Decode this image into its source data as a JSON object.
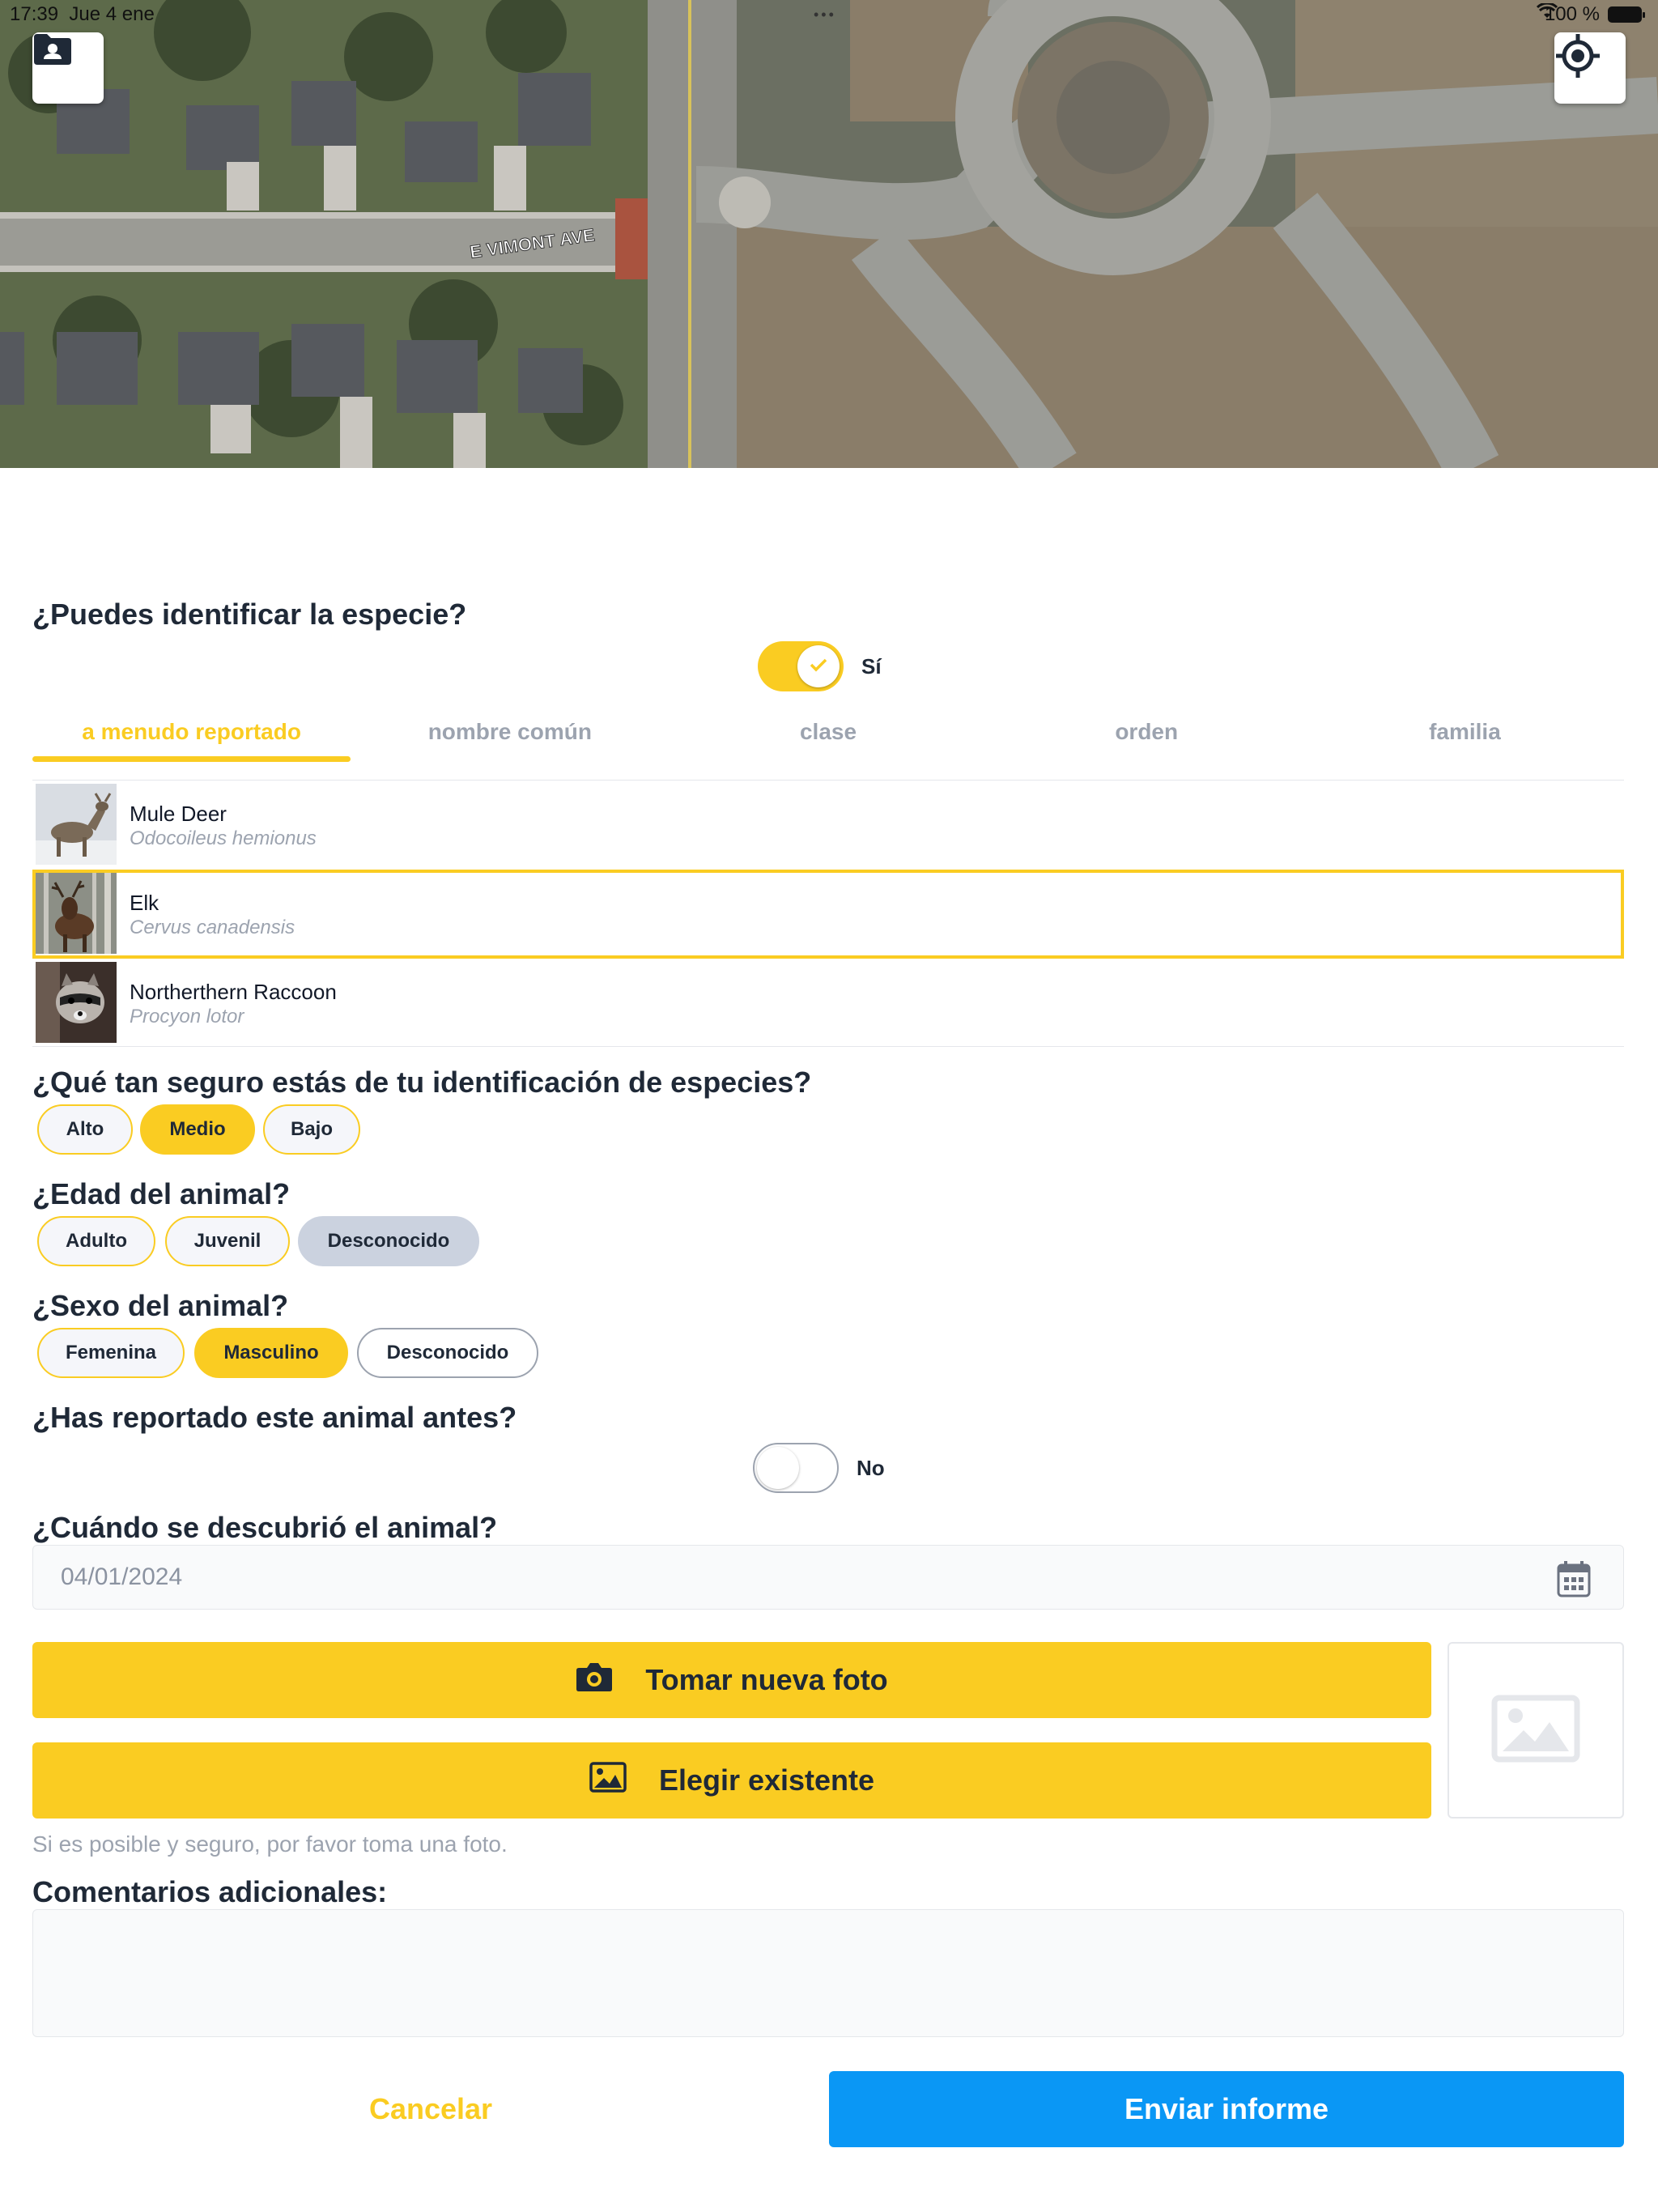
{
  "status_bar": {
    "time": "17:39",
    "date": "Jue 4 ene",
    "battery": "100 %"
  },
  "map": {
    "street_label": "E VIMONT AVE"
  },
  "identify": {
    "question": "¿Puedes identificar la especie?",
    "toggle_label": "Sí",
    "toggle_on": true
  },
  "tabs": [
    {
      "label": "a menudo reportado"
    },
    {
      "label": "nombre común"
    },
    {
      "label": "clase"
    },
    {
      "label": "orden"
    },
    {
      "label": "familia"
    }
  ],
  "species": [
    {
      "common": "Mule Deer",
      "scientific": "Odocoileus hemionus"
    },
    {
      "common": "Elk",
      "scientific": "Cervus canadensis"
    },
    {
      "common": "Northerthern Raccoon",
      "scientific": "Procyon lotor"
    }
  ],
  "selected_species_index": 1,
  "confidence": {
    "question": "¿Qué tan seguro estás de tu identificación de especies?",
    "options": [
      "Alto",
      "Medio",
      "Bajo"
    ],
    "selected": "Medio"
  },
  "age": {
    "question": "¿Edad del animal?",
    "options": [
      "Adulto",
      "Juvenil",
      "Desconocido"
    ],
    "selected": "Desconocido"
  },
  "sex": {
    "question": "¿Sexo del animal?",
    "options": [
      "Femenina",
      "Masculino",
      "Desconocido"
    ],
    "selected": "Masculino"
  },
  "reported_before": {
    "question": "¿Has reportado este animal antes?",
    "toggle_label": "No",
    "toggle_on": false
  },
  "discovered": {
    "question": "¿Cuándo se descubrió el animal?",
    "date": "04/01/2024"
  },
  "photo": {
    "take_label": "Tomar nueva foto",
    "choose_label": "Elegir existente",
    "hint": "Si es posible y seguro, por favor toma una foto."
  },
  "comments": {
    "label": "Comentarios adicionales:",
    "value": ""
  },
  "actions": {
    "cancel": "Cancelar",
    "submit": "Enviar informe"
  },
  "colors": {
    "accent": "#facc22",
    "primary": "#0a97f5",
    "unknown_pill": "#cbd2df"
  },
  "icons": {
    "map_left": "contact-folder-icon",
    "map_right": "locate-icon",
    "date": "calendar-icon",
    "take_photo": "camera-icon",
    "choose_photo": "image-icon",
    "placeholder": "image-placeholder-icon"
  }
}
